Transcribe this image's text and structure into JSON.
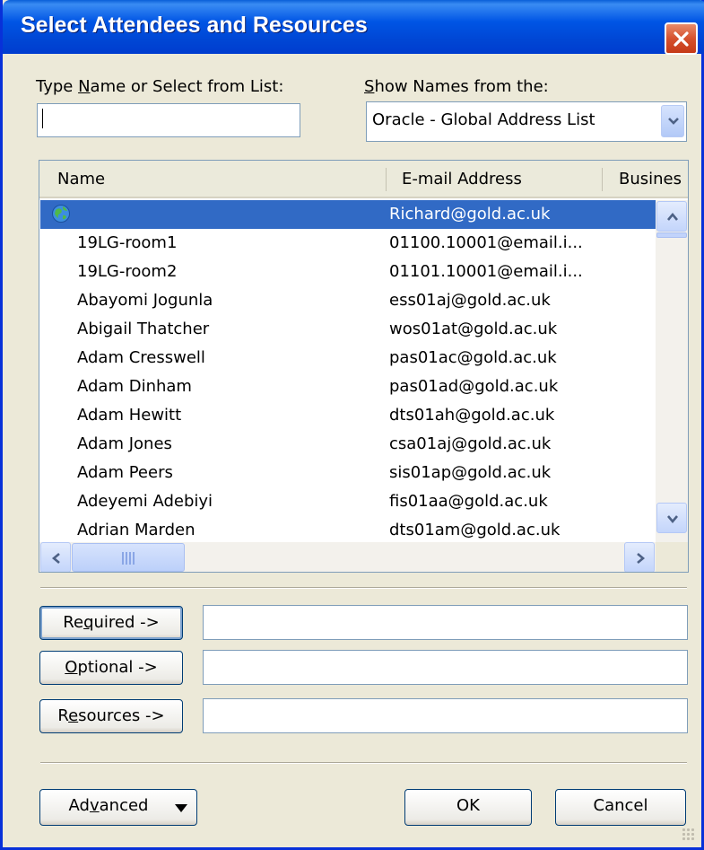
{
  "window": {
    "title": "Select Attendees and Resources"
  },
  "search": {
    "label": "Type Name or Select from List:",
    "label_accel": "N",
    "value": ""
  },
  "address_book": {
    "label": "Show Names from the:",
    "label_accel": "S",
    "selected": "Oracle - Global Address List"
  },
  "list": {
    "columns": [
      "Name",
      "E-mail Address",
      "Busines"
    ],
    "rows": [
      {
        "name": "",
        "email": "Richard@gold.ac.uk",
        "icon": "globe-icon",
        "selected": true
      },
      {
        "name": "19LG-room1",
        "email": "01100.10001@email.i..."
      },
      {
        "name": "19LG-room2",
        "email": "01101.10001@email.i..."
      },
      {
        "name": "Abayomi Jogunla",
        "email": "ess01aj@gold.ac.uk"
      },
      {
        "name": "Abigail Thatcher",
        "email": "wos01at@gold.ac.uk"
      },
      {
        "name": "Adam Cresswell",
        "email": "pas01ac@gold.ac.uk"
      },
      {
        "name": "Adam Dinham",
        "email": "pas01ad@gold.ac.uk"
      },
      {
        "name": "Adam Hewitt",
        "email": "dts01ah@gold.ac.uk"
      },
      {
        "name": "Adam Jones",
        "email": "csa01aj@gold.ac.uk"
      },
      {
        "name": "Adam Peers",
        "email": "sis01ap@gold.ac.uk"
      },
      {
        "name": "Adeyemi Adebiyi",
        "email": "fis01aa@gold.ac.uk"
      },
      {
        "name": "Adrian Marden",
        "email": "dts01am@gold.ac.uk"
      }
    ]
  },
  "recipients": {
    "required_label": "Required ->",
    "required_value": "",
    "optional_label": "Optional ->",
    "optional_value": "",
    "resources_label": "Resources ->",
    "resources_value": ""
  },
  "footer": {
    "advanced_label": "Advanced",
    "ok_label": "OK",
    "cancel_label": "Cancel"
  },
  "colors": {
    "titlebar": "#0055e5",
    "selection": "#316ac5",
    "dialog_bg": "#ece9d8",
    "close": "#d6512e"
  }
}
